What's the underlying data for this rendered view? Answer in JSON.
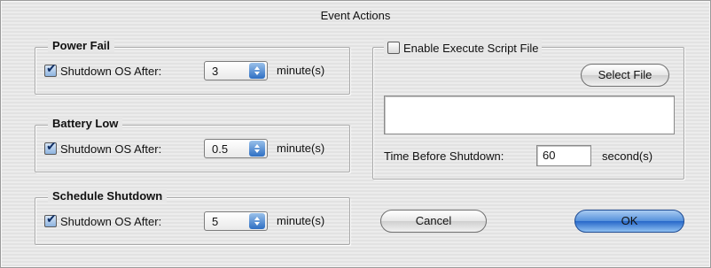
{
  "window": {
    "title": "Event Actions"
  },
  "groups": [
    {
      "legend": "Power Fail",
      "checkbox_label": "Shutdown OS After:",
      "checked": true,
      "value": "3",
      "unit": "minute(s)"
    },
    {
      "legend": "Battery Low",
      "checkbox_label": "Shutdown OS After:",
      "checked": true,
      "value": "0.5",
      "unit": "minute(s)"
    },
    {
      "legend": "Schedule Shutdown",
      "checkbox_label": "Shutdown OS After:",
      "checked": true,
      "value": "5",
      "unit": "minute(s)"
    }
  ],
  "script": {
    "enable_label": "Enable Execute Script File",
    "enabled": false,
    "select_file_label": "Select File",
    "file_path": "",
    "time_label": "Time Before Shutdown:",
    "time_value": "60",
    "time_unit": "second(s)"
  },
  "buttons": {
    "cancel": "Cancel",
    "ok": "OK"
  },
  "colors": {
    "accent": "#2e6fc3",
    "check": "#0d2c63"
  }
}
